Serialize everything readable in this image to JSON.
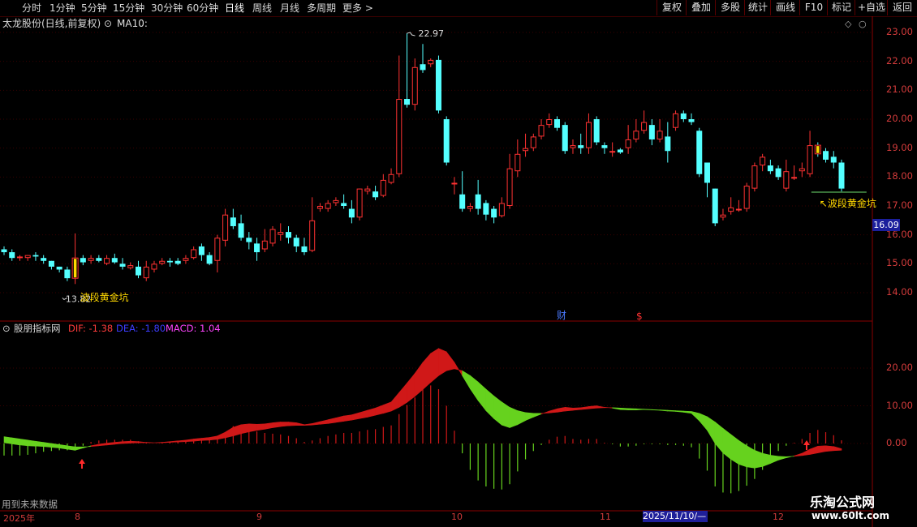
{
  "toolbar": {
    "periods": [
      "分时",
      "1分钟",
      "5分钟",
      "15分钟",
      "30分钟",
      "60分钟",
      "日线",
      "周线",
      "月线",
      "多周期",
      "更多"
    ],
    "active_period": "日线",
    "right_buttons": [
      "复权",
      "叠加",
      "多股",
      "统计",
      "画线",
      "F10",
      "标记",
      "+自选",
      "返回"
    ]
  },
  "main_title": {
    "stock": "太龙股份(日线,前复权)",
    "ma": "MA10:"
  },
  "indicator_title": {
    "name": "股朋指标网",
    "dif": "DIF: -1.38",
    "dea": "DEA: -1.80",
    "macd": "MACD: 1.04"
  },
  "price_axis": [
    "23.00",
    "22.00",
    "21.00",
    "20.00",
    "19.00",
    "18.00",
    "17.00",
    "16.00",
    "15.00",
    "14.00"
  ],
  "indicator_axis": [
    "20.00",
    "10.00",
    "0.00"
  ],
  "current_price": "16.09",
  "annotations": {
    "high": "22.97",
    "low": "13.82",
    "signal1": "波段黄金坑",
    "signal2": "↖波段黄金坑",
    "fin_marker": "财",
    "dollar_marker": "$"
  },
  "date_axis": {
    "year": "2025年",
    "months": [
      "8",
      "9",
      "10",
      "11",
      "12"
    ],
    "cursor_date": "2025/11/10/—"
  },
  "future_data_note": "用到未来数据",
  "watermark": {
    "name": "乐淘公式网",
    "url": "www.60lt.com"
  },
  "colors": {
    "up": "#ff3232",
    "down": "#54ffff",
    "signal": "#ffd800",
    "macd_red": "#d01818",
    "macd_green": "#66d21e"
  },
  "chart_data": {
    "type": "candlestick",
    "ylim": [
      13.5,
      23.2
    ],
    "candles": [
      [
        15.5,
        15.4,
        15.6,
        15.3
      ],
      [
        15.4,
        15.2,
        15.5,
        15.1
      ],
      [
        15.2,
        15.25,
        15.3,
        15.1
      ],
      [
        15.2,
        15.3,
        15.3,
        15.1
      ],
      [
        15.3,
        15.25,
        15.4,
        15.1
      ],
      [
        15.2,
        15.1,
        15.3,
        15.0
      ],
      [
        15.1,
        14.9,
        15.1,
        14.8
      ],
      [
        14.9,
        14.8,
        14.9,
        14.7
      ],
      [
        14.8,
        14.5,
        14.9,
        14.4
      ],
      [
        14.5,
        15.2,
        16.05,
        14.3
      ],
      [
        15.2,
        15.05,
        15.3,
        14.95
      ],
      [
        15.1,
        15.2,
        15.3,
        15.0
      ],
      [
        15.2,
        15.1,
        15.3,
        15.05
      ],
      [
        15.0,
        15.2,
        15.3,
        14.95
      ],
      [
        15.2,
        15.05,
        15.35,
        15.0
      ],
      [
        15.0,
        14.9,
        15.2,
        14.8
      ],
      [
        14.85,
        14.95,
        15.05,
        14.8
      ],
      [
        14.9,
        14.6,
        15.1,
        14.5
      ],
      [
        14.5,
        14.9,
        15.1,
        14.4
      ],
      [
        14.8,
        15.0,
        15.1,
        14.7
      ],
      [
        15.0,
        15.1,
        15.2,
        14.95
      ],
      [
        15.1,
        15.05,
        15.2,
        14.9
      ],
      [
        15.1,
        15.0,
        15.2,
        14.95
      ],
      [
        15.1,
        15.2,
        15.3,
        15.0
      ],
      [
        15.2,
        15.5,
        15.6,
        15.15
      ],
      [
        15.6,
        15.3,
        15.7,
        15.1
      ],
      [
        15.3,
        15.0,
        15.4,
        14.95
      ],
      [
        15.1,
        15.9,
        16.0,
        14.7
      ],
      [
        15.8,
        16.7,
        16.9,
        15.6
      ],
      [
        16.6,
        16.3,
        16.9,
        16.2
      ],
      [
        16.4,
        15.9,
        16.7,
        15.8
      ],
      [
        15.9,
        15.75,
        16.1,
        15.5
      ],
      [
        15.7,
        15.4,
        15.9,
        15.1
      ],
      [
        15.5,
        15.8,
        16.2,
        15.4
      ],
      [
        15.7,
        16.2,
        16.3,
        15.6
      ],
      [
        16.0,
        16.1,
        16.4,
        15.8
      ],
      [
        16.1,
        15.9,
        16.3,
        15.7
      ],
      [
        15.9,
        15.6,
        16.0,
        15.4
      ],
      [
        15.6,
        15.4,
        15.9,
        15.3
      ],
      [
        15.45,
        16.5,
        17.3,
        15.4
      ],
      [
        16.9,
        17.0,
        17.1,
        16.8
      ],
      [
        16.9,
        17.1,
        17.2,
        16.8
      ],
      [
        17.1,
        17.2,
        17.3,
        17.0
      ],
      [
        17.1,
        17.0,
        17.4,
        16.9
      ],
      [
        16.9,
        16.6,
        17.2,
        16.4
      ],
      [
        16.6,
        17.6,
        17.6,
        16.5
      ],
      [
        17.5,
        17.6,
        17.7,
        17.4
      ],
      [
        17.5,
        17.3,
        17.7,
        17.2
      ],
      [
        17.35,
        17.9,
        18.1,
        17.3
      ],
      [
        17.8,
        18.1,
        18.3,
        17.75
      ],
      [
        18.1,
        20.7,
        22.2,
        18.0
      ],
      [
        20.7,
        20.5,
        22.97,
        20.4
      ],
      [
        20.5,
        21.8,
        22.1,
        20.3
      ],
      [
        21.9,
        21.7,
        22.6,
        21.6
      ],
      [
        21.9,
        22.05,
        22.1,
        21.8
      ],
      [
        22.05,
        20.3,
        22.2,
        20.2
      ],
      [
        20.0,
        18.5,
        20.1,
        18.4
      ],
      [
        17.8,
        17.8,
        18.0,
        17.4
      ],
      [
        17.4,
        16.9,
        18.2,
        16.8
      ],
      [
        16.9,
        17.0,
        17.1,
        16.8
      ],
      [
        17.4,
        16.9,
        17.9,
        16.7
      ],
      [
        17.1,
        16.7,
        17.2,
        16.5
      ],
      [
        16.9,
        16.6,
        17.0,
        16.4
      ],
      [
        16.65,
        17.1,
        17.3,
        16.6
      ],
      [
        17.0,
        18.3,
        18.8,
        16.9
      ],
      [
        18.2,
        18.8,
        19.3,
        18.0
      ],
      [
        18.9,
        19.0,
        19.5,
        18.7
      ],
      [
        19.0,
        19.4,
        19.5,
        18.9
      ],
      [
        19.4,
        19.8,
        20.0,
        19.3
      ],
      [
        19.8,
        20.0,
        20.2,
        19.7
      ],
      [
        20.0,
        19.7,
        20.1,
        19.6
      ],
      [
        19.8,
        18.9,
        19.9,
        18.8
      ],
      [
        19.0,
        19.1,
        19.3,
        18.8
      ],
      [
        19.1,
        19.0,
        19.5,
        18.8
      ],
      [
        19.0,
        19.9,
        20.2,
        18.8
      ],
      [
        20.0,
        19.2,
        20.1,
        19.1
      ],
      [
        19.1,
        19.0,
        19.2,
        18.8
      ],
      [
        18.9,
        18.9,
        19.2,
        18.7
      ],
      [
        18.95,
        18.85,
        19.0,
        18.8
      ],
      [
        19.0,
        19.3,
        19.8,
        18.8
      ],
      [
        19.3,
        19.6,
        20.0,
        19.2
      ],
      [
        19.6,
        19.9,
        20.3,
        19.5
      ],
      [
        19.8,
        19.3,
        20.0,
        19.1
      ],
      [
        19.3,
        19.6,
        20.0,
        19.2
      ],
      [
        19.4,
        18.9,
        19.9,
        18.5
      ],
      [
        19.7,
        20.2,
        20.3,
        19.6
      ],
      [
        20.2,
        20.0,
        20.3,
        19.9
      ],
      [
        20.0,
        19.9,
        20.2,
        19.8
      ],
      [
        19.6,
        18.1,
        19.7,
        18.0
      ],
      [
        18.5,
        17.8,
        18.5,
        17.3
      ],
      [
        17.6,
        16.4,
        17.6,
        16.3
      ],
      [
        16.6,
        16.7,
        16.9,
        16.5
      ],
      [
        16.8,
        16.95,
        17.3,
        16.7
      ],
      [
        16.85,
        16.9,
        17.2,
        16.8
      ],
      [
        16.9,
        17.7,
        17.8,
        16.8
      ],
      [
        17.6,
        18.4,
        18.5,
        17.5
      ],
      [
        18.4,
        18.7,
        18.8,
        18.2
      ],
      [
        18.4,
        18.2,
        18.6,
        18.1
      ],
      [
        18.3,
        18.0,
        18.4,
        17.9
      ],
      [
        17.6,
        18.2,
        18.6,
        17.5
      ],
      [
        18.0,
        18.0,
        18.4,
        17.9
      ],
      [
        18.2,
        18.3,
        18.5,
        18.0
      ],
      [
        18.1,
        19.1,
        19.6,
        18.0
      ],
      [
        19.1,
        18.8,
        19.2,
        18.7
      ],
      [
        18.9,
        18.6,
        19.0,
        18.5
      ],
      [
        18.7,
        18.5,
        18.9,
        18.3
      ],
      [
        18.5,
        17.6,
        18.6,
        17.5
      ]
    ],
    "signal_candles": [
      9,
      103
    ],
    "macd": {
      "dif": [
        0.2,
        -0.1,
        -0.4,
        -0.6,
        -0.7,
        -0.8,
        -1.0,
        -1.2,
        -1.5,
        -1.8,
        -1.2,
        -0.6,
        -0.2,
        0.1,
        0.3,
        0.5,
        0.6,
        0.5,
        0.3,
        0.2,
        0.3,
        0.5,
        0.7,
        0.9,
        1.2,
        1.4,
        1.6,
        2.0,
        3.0,
        4.3,
        5.0,
        5.2,
        5.1,
        5.2,
        5.5,
        5.7,
        5.7,
        5.5,
        5.0,
        5.3,
        5.8,
        6.3,
        6.8,
        7.3,
        7.6,
        8.2,
        8.8,
        9.4,
        10.2,
        11.0,
        13.5,
        16.0,
        18.6,
        21.5,
        23.9,
        25.2,
        24.3,
        21.5,
        18.0,
        14.5,
        11.4,
        8.7,
        6.6,
        4.9,
        4.2,
        5.0,
        6.1,
        7.0,
        7.8,
        8.6,
        9.2,
        9.6,
        9.4,
        9.5,
        9.8,
        10.0,
        9.6,
        9.4,
        9.0,
        8.9,
        8.9,
        9.0,
        8.9,
        8.8,
        8.6,
        8.5,
        8.3,
        8.0,
        6.0,
        3.5,
        0.0,
        -2.5,
        -4.2,
        -5.5,
        -6.2,
        -6.5,
        -6.1,
        -5.3,
        -4.4,
        -3.8,
        -3.3,
        -2.6,
        -1.5,
        -0.7,
        -0.6,
        -0.8,
        -1.38
      ],
      "dea": [
        1.8,
        1.5,
        1.2,
        0.9,
        0.6,
        0.3,
        0.0,
        -0.3,
        -0.6,
        -0.9,
        -0.9,
        -0.8,
        -0.6,
        -0.4,
        -0.2,
        0.0,
        0.1,
        0.2,
        0.2,
        0.2,
        0.2,
        0.3,
        0.4,
        0.5,
        0.6,
        0.8,
        0.9,
        1.1,
        1.5,
        2.0,
        2.6,
        3.1,
        3.5,
        3.8,
        4.2,
        4.5,
        4.7,
        4.8,
        4.8,
        4.9,
        5.1,
        5.3,
        5.6,
        5.9,
        6.2,
        6.6,
        7.0,
        7.5,
        8.0,
        8.6,
        9.6,
        10.9,
        12.5,
        14.3,
        16.2,
        18.0,
        19.3,
        19.8,
        19.3,
        18.0,
        16.3,
        14.4,
        12.6,
        11.0,
        9.6,
        8.7,
        8.2,
        8.0,
        8.0,
        8.1,
        8.3,
        8.6,
        8.8,
        9.0,
        9.2,
        9.4,
        9.5,
        9.5,
        9.4,
        9.3,
        9.2,
        9.1,
        9.0,
        8.9,
        8.8,
        8.7,
        8.6,
        8.5,
        8.0,
        7.1,
        5.7,
        4.0,
        2.4,
        0.8,
        -0.6,
        -1.8,
        -2.6,
        -3.1,
        -3.4,
        -3.5,
        -3.4,
        -3.2,
        -2.9,
        -2.5,
        -2.1,
        -1.9,
        -1.8
      ]
    },
    "macd_axis_range": [
      -14,
      30
    ]
  }
}
